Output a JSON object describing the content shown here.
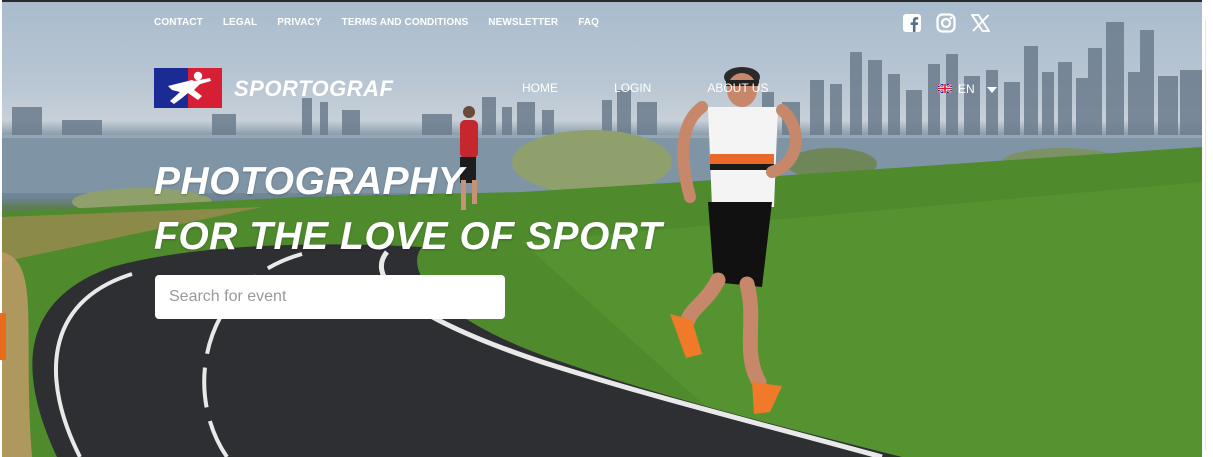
{
  "top_nav": {
    "items": [
      "CONTACT",
      "LEGAL",
      "PRIVACY",
      "TERMS AND CONDITIONS",
      "NEWSLETTER",
      "FAQ"
    ]
  },
  "social": {
    "icons": [
      "facebook-icon",
      "instagram-icon",
      "x-icon"
    ]
  },
  "brand": {
    "name": "SPORTOGRAF",
    "colors": {
      "blue": "#1b2b95",
      "red": "#d61f35"
    }
  },
  "main_nav": {
    "items": [
      "HOME",
      "LOGIN",
      "ABOUT US"
    ]
  },
  "language": {
    "code": "EN",
    "flag": "uk-flag-icon"
  },
  "hero": {
    "headline_line1": "PHOTOGRAPHY",
    "headline_line2": "FOR THE LOVE OF SPORT"
  },
  "search": {
    "placeholder": "Search for event",
    "value": ""
  },
  "accent": "#e86c1c"
}
